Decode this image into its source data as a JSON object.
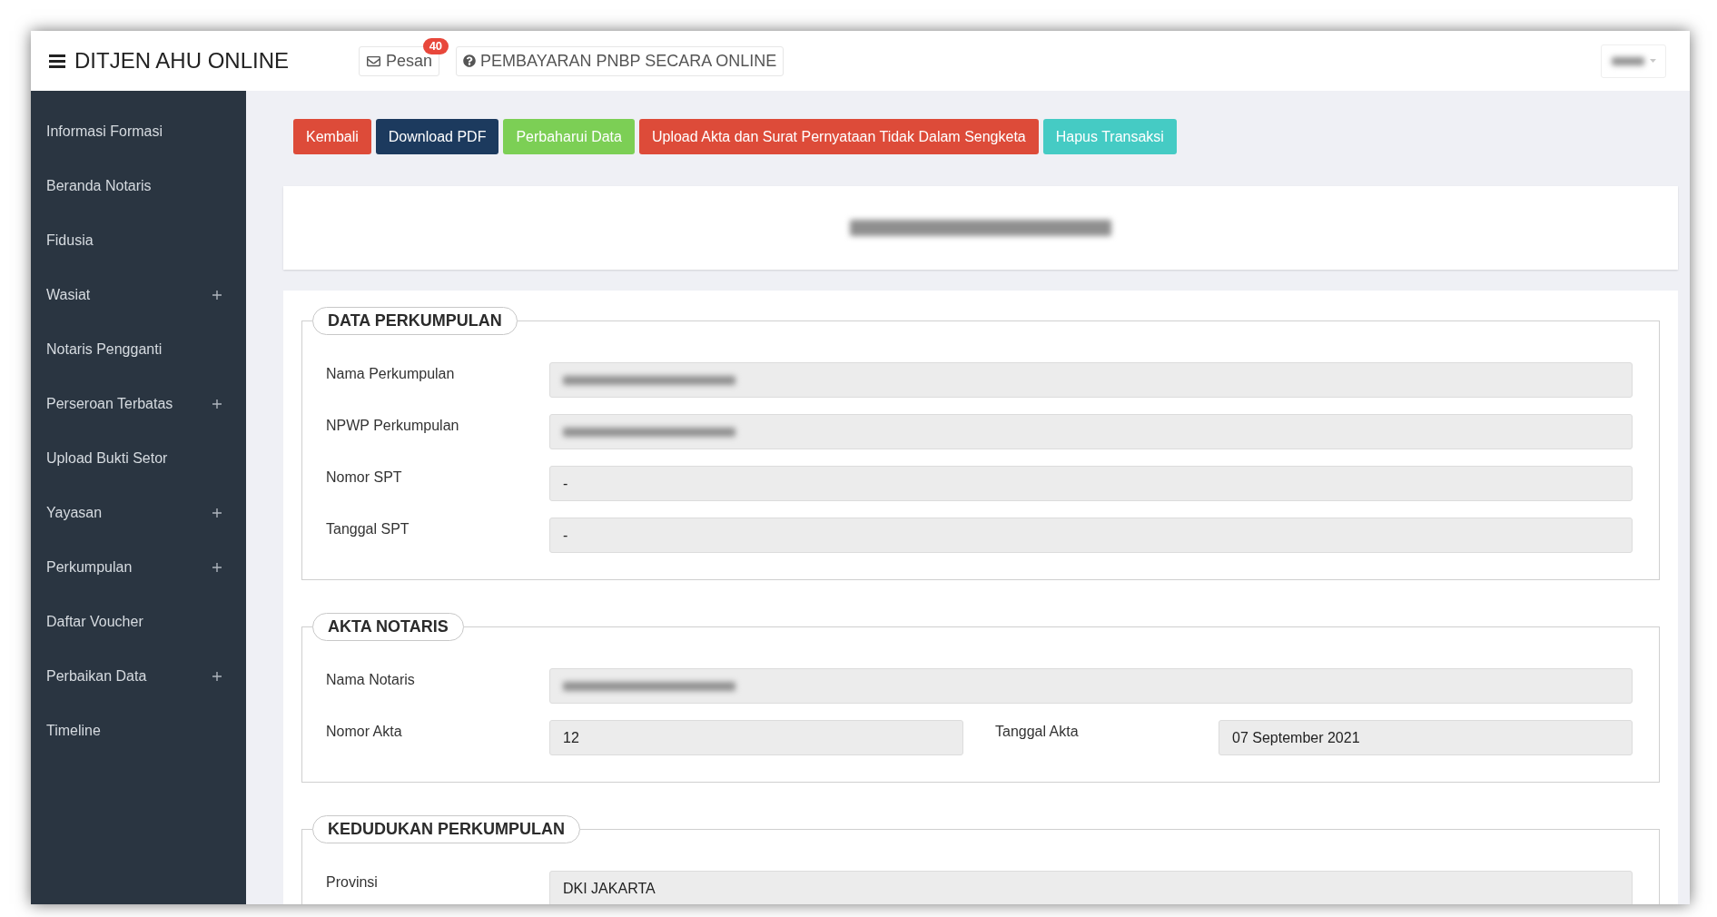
{
  "header": {
    "title": "DITJEN AHU ONLINE",
    "messages": {
      "label": "Pesan",
      "badge": "40"
    },
    "payment_link": {
      "label": "PEMBAYARAN PNBP SECARA ONLINE"
    },
    "user_menu": {
      "redacted": true
    }
  },
  "sidebar": {
    "items": [
      {
        "label": "Informasi Formasi",
        "expandable": false
      },
      {
        "label": "Beranda Notaris",
        "expandable": false
      },
      {
        "label": "Fidusia",
        "expandable": false
      },
      {
        "label": "Wasiat",
        "expandable": true
      },
      {
        "label": "Notaris Pengganti",
        "expandable": false
      },
      {
        "label": "Perseroan Terbatas",
        "expandable": true
      },
      {
        "label": "Upload Bukti Setor",
        "expandable": false
      },
      {
        "label": "Yayasan",
        "expandable": true
      },
      {
        "label": "Perkumpulan",
        "expandable": true
      },
      {
        "label": "Daftar Voucher",
        "expandable": false
      },
      {
        "label": "Perbaikan Data",
        "expandable": true
      },
      {
        "label": "Timeline",
        "expandable": false
      }
    ]
  },
  "actions": [
    {
      "label": "Kembali",
      "color": "#dd4b39"
    },
    {
      "label": "Download PDF",
      "color": "#1c3a5e"
    },
    {
      "label": "Perbaharui Data",
      "color": "#7ccf55"
    },
    {
      "label": "Upload Akta dan Surat Pernyataan Tidak Dalam Sengketa",
      "color": "#dd4b39"
    },
    {
      "label": "Hapus Transaksi",
      "color": "#45cbc4"
    }
  ],
  "record_title": {
    "redacted": true
  },
  "sections": [
    {
      "title": "DATA PERKUMPULAN",
      "rows": [
        [
          {
            "label": "Nama Perkumpulan",
            "kind": "blurred"
          }
        ],
        [
          {
            "label": "NPWP Perkumpulan",
            "kind": "blurred"
          }
        ],
        [
          {
            "label": "Nomor SPT",
            "kind": "text",
            "value": "-"
          }
        ],
        [
          {
            "label": "Tanggal SPT",
            "kind": "text",
            "value": "-"
          }
        ]
      ]
    },
    {
      "title": "AKTA NOTARIS",
      "rows": [
        [
          {
            "label": "Nama Notaris",
            "kind": "blurred"
          }
        ],
        [
          {
            "label": "Nomor Akta",
            "kind": "text",
            "value": "12"
          },
          {
            "label": "Tanggal Akta",
            "kind": "text",
            "value": "07 September 2021"
          }
        ]
      ]
    },
    {
      "title": "KEDUDUKAN PERKUMPULAN",
      "rows": [
        [
          {
            "label": "Provinsi",
            "kind": "text",
            "value": "DKI JAKARTA"
          }
        ]
      ]
    }
  ]
}
